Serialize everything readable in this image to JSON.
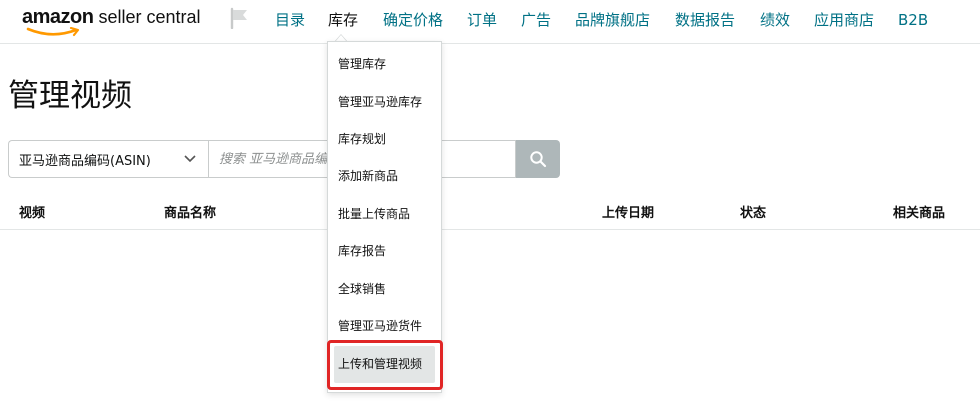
{
  "header": {
    "logo_amazon": "amazon",
    "logo_rest": "seller central",
    "nav": [
      {
        "label": "目录",
        "active": false
      },
      {
        "label": "库存",
        "active": true
      },
      {
        "label": "确定价格",
        "active": false
      },
      {
        "label": "订单",
        "active": false
      },
      {
        "label": "广告",
        "active": false
      },
      {
        "label": "品牌旗舰店",
        "active": false
      },
      {
        "label": "数据报告",
        "active": false
      },
      {
        "label": "绩效",
        "active": false
      },
      {
        "label": "应用商店",
        "active": false
      },
      {
        "label": "B2B",
        "active": false
      }
    ],
    "flag_icon": "flag-icon"
  },
  "page": {
    "title": "管理视频"
  },
  "search": {
    "select_value": "亚马逊商品编码(ASIN)",
    "placeholder": "搜索 亚马逊商品编",
    "button_icon": "search-icon"
  },
  "table": {
    "columns": [
      "视频",
      "商品名称",
      "上传日期",
      "状态",
      "相关商品"
    ]
  },
  "inventory_menu": {
    "items": [
      "管理库存",
      "管理亚马逊库存",
      "库存规划",
      "添加新商品",
      "批量上传商品",
      "库存报告",
      "全球销售",
      "管理亚马逊货件",
      "上传和管理视频"
    ],
    "highlighted_index": 8
  },
  "colors": {
    "link": "#007185",
    "highlight_border": "#e02525",
    "search_button": "#aeb7b9"
  }
}
